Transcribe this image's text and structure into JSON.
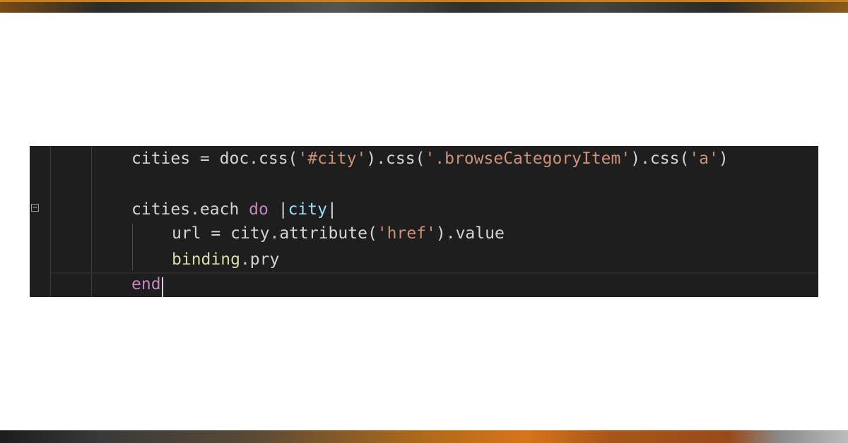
{
  "fold_marker": "−",
  "code": {
    "line1": {
      "a": "cities = doc.css(",
      "s1": "'#city'",
      "b": ").css(",
      "s2": "'.browseCategoryItem'",
      "c": ").css(",
      "s3": "'a'",
      "d": ")"
    },
    "line3": {
      "a": "cities.each ",
      "kw": "do",
      "b": " |",
      "var": "city",
      "c": "|"
    },
    "line4": {
      "a": "url = city.attribute(",
      "s": "'href'",
      "b": ").value"
    },
    "line5": {
      "fn": "binding",
      "a": ".pry"
    },
    "line6": {
      "kw": "end"
    }
  },
  "colors": {
    "editor_background": "#1e1e1e",
    "default_text": "#d4d4d4",
    "string": "#ce9178",
    "keyword": "#c586c0",
    "variable": "#9cdcfe",
    "function": "#dcdcaa",
    "top_accent": "#c8801e"
  }
}
